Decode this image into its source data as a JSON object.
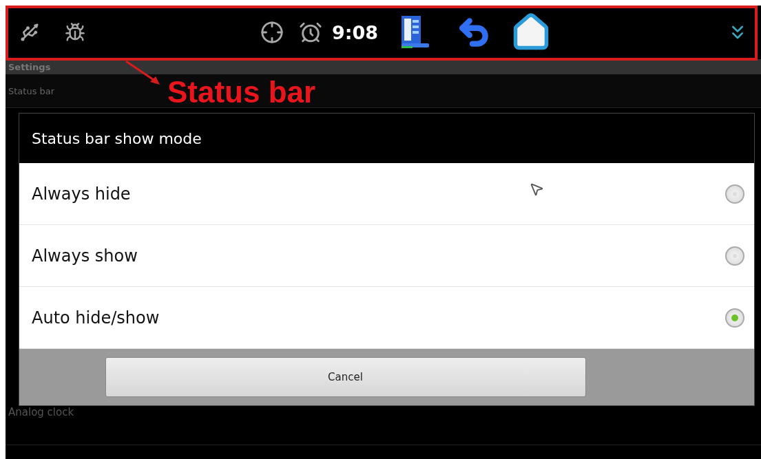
{
  "status_bar": {
    "time": "9:08"
  },
  "annotation": {
    "label": "Status bar"
  },
  "background": {
    "header": "Settings",
    "first_item": "Status bar",
    "last_item_summary": "Analog clock"
  },
  "dialog": {
    "title": "Status bar show mode",
    "options": [
      {
        "label": "Always hide",
        "selected": false
      },
      {
        "label": "Always show",
        "selected": false
      },
      {
        "label": "Auto hide/show",
        "selected": true
      }
    ],
    "cancel": "Cancel"
  }
}
